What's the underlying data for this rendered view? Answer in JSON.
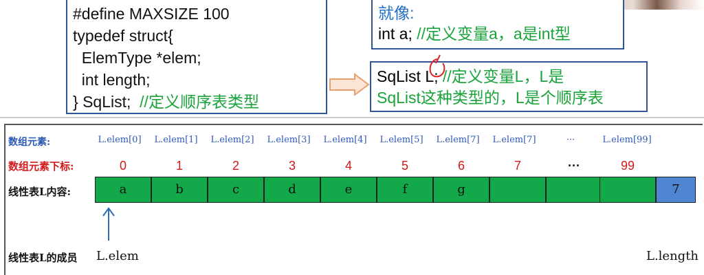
{
  "code": {
    "line1": "#define MAXSIZE 100",
    "line2": "typedef struct{",
    "line3": "  ElemType *elem;",
    "line4": "  int length;",
    "line5_code": "} SqList;",
    "line5_comment": "//定义顺序表类型"
  },
  "like": {
    "title": "就像:",
    "code": "int a;",
    "comment": "//定义变量a，a是int型"
  },
  "sqlist": {
    "code": "SqList L;",
    "comment1": "//定义变量L，L是",
    "comment2": "SqList这种类型的，L是个顺序表"
  },
  "table": {
    "row_labels": {
      "elements": "数组元素:",
      "indices": "数组元素下标:",
      "contents": "线性表L内容:",
      "members": "线性表L的成员"
    },
    "element_names": [
      "L.elem[0]",
      "L.elem[1]",
      "L.elem[2]",
      "L.elem[3]",
      "L.elem[4]",
      "L.elem[5]",
      "L.elem[7]",
      "L.elem[7]",
      "···",
      "L.elem[99]"
    ],
    "subscripts": [
      "0",
      "1",
      "2",
      "3",
      "4",
      "5",
      "6",
      "7",
      "···",
      "99"
    ],
    "cells": [
      "a",
      "b",
      "c",
      "d",
      "e",
      "f",
      "g",
      "",
      "",
      "",
      "7"
    ],
    "member_elem": "L.elem",
    "member_length": "L.length"
  },
  "colors": {
    "cell_fill": "#13a84a",
    "length_fill": "#4f86d1",
    "index_text": "#2c59b5",
    "subscript_text": "#d11a1a",
    "comment_text": "#1aa33a"
  }
}
